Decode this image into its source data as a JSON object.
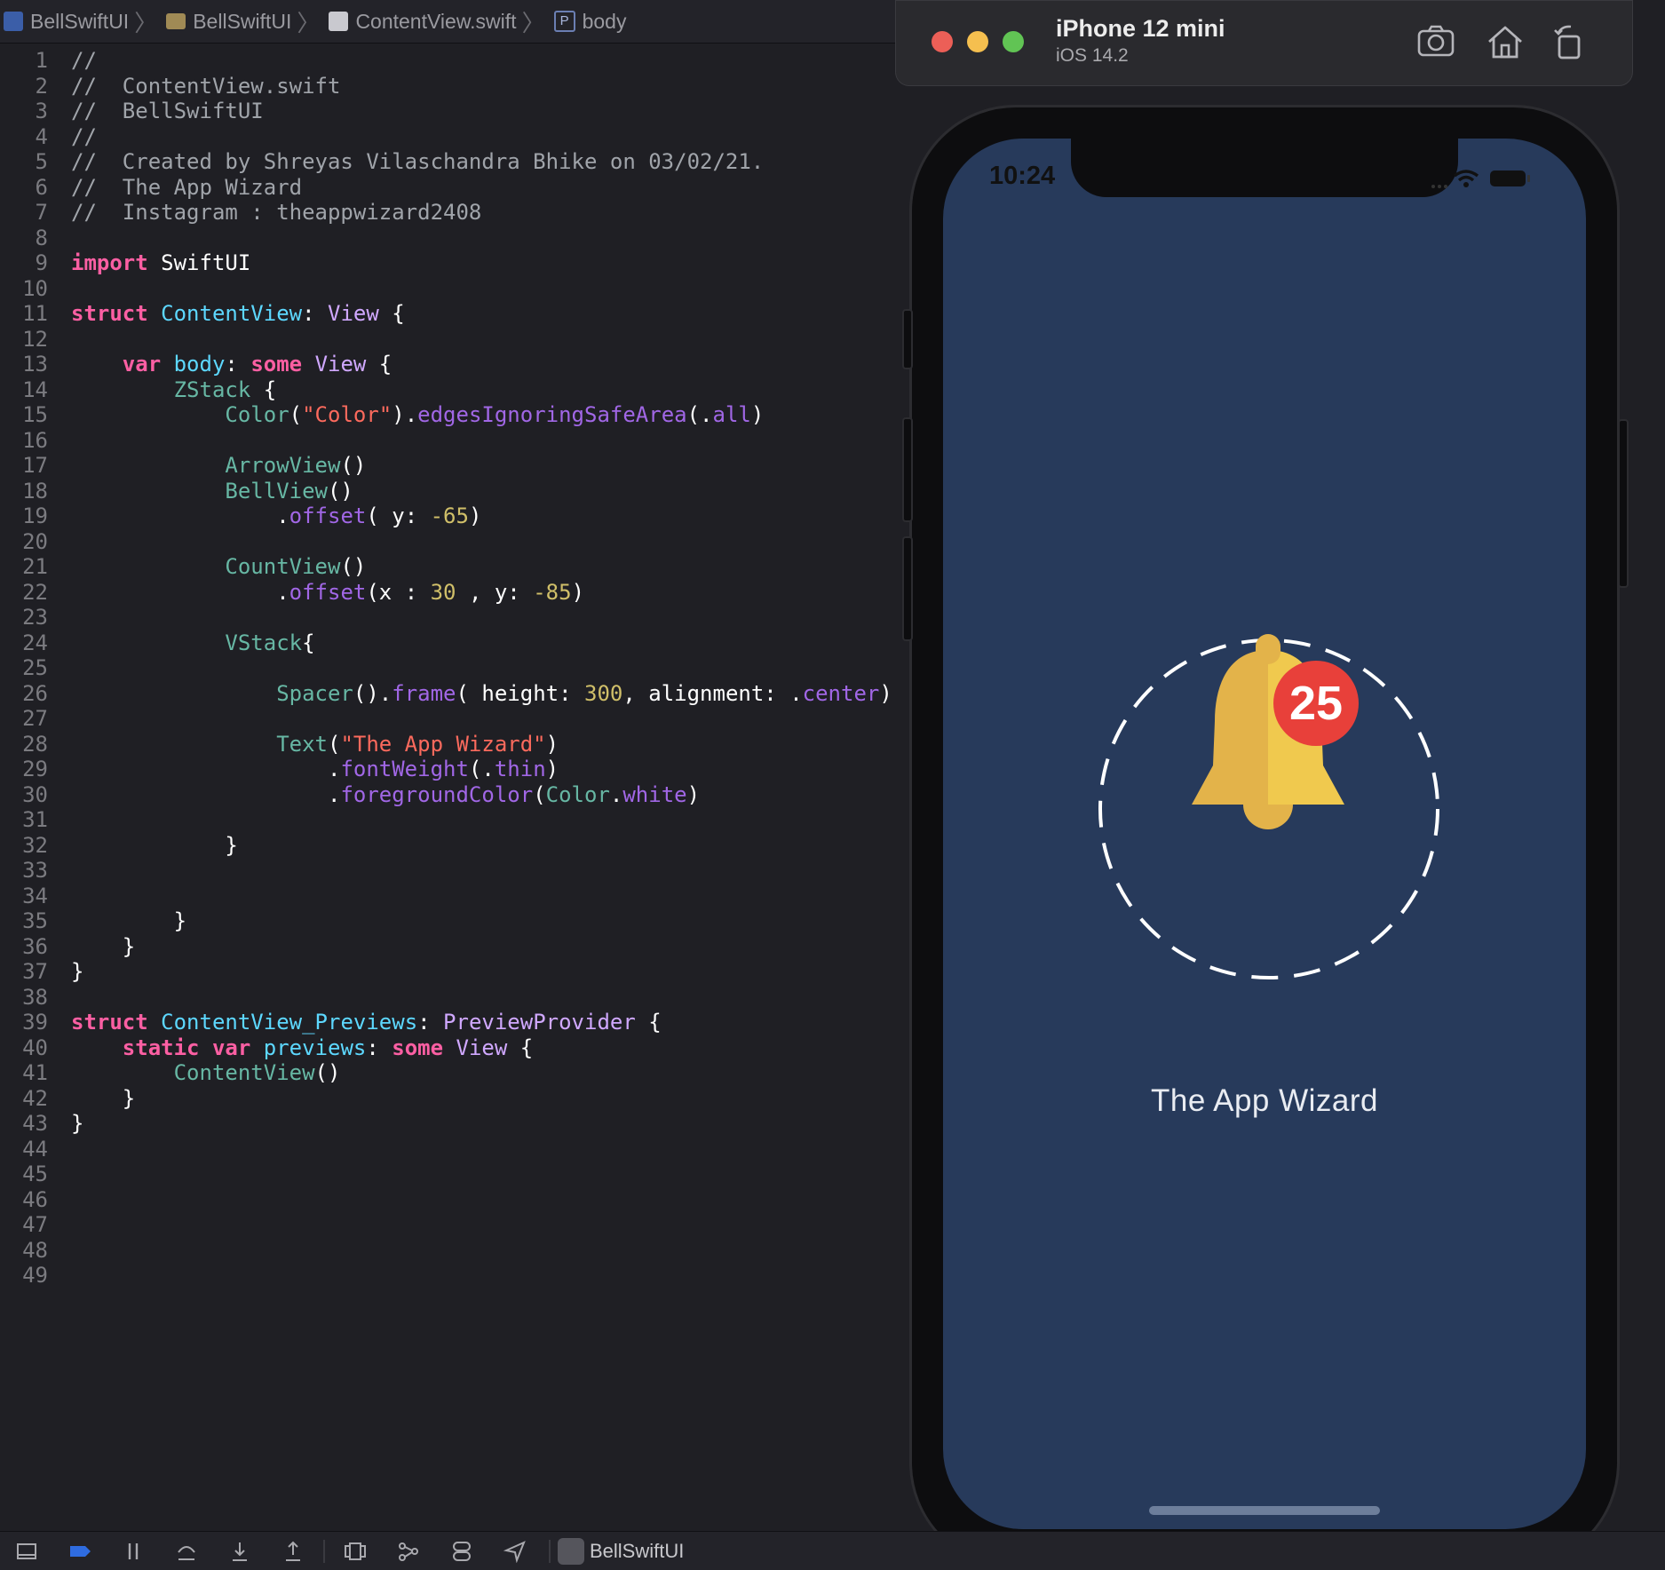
{
  "breadcrumb": {
    "project": "BellSwiftUI",
    "folder": "BellSwiftUI",
    "file": "ContentView.swift",
    "symbol_badge": "P",
    "symbol": "body"
  },
  "editor": {
    "lines": [
      {
        "n": "1",
        "tokens": [
          {
            "c": "t-comment",
            "t": "//"
          }
        ]
      },
      {
        "n": "2",
        "tokens": [
          {
            "c": "t-comment",
            "t": "//  ContentView.swift"
          }
        ]
      },
      {
        "n": "3",
        "tokens": [
          {
            "c": "t-comment",
            "t": "//  BellSwiftUI"
          }
        ]
      },
      {
        "n": "4",
        "tokens": [
          {
            "c": "t-comment",
            "t": "//"
          }
        ]
      },
      {
        "n": "5",
        "tokens": [
          {
            "c": "t-comment",
            "t": "//  Created by Shreyas Vilaschandra Bhike on 03/02/21."
          }
        ]
      },
      {
        "n": "6",
        "tokens": [
          {
            "c": "t-comment",
            "t": "//  The App Wizard"
          }
        ]
      },
      {
        "n": "7",
        "tokens": [
          {
            "c": "t-comment",
            "t": "//  Instagram : theappwizard2408"
          }
        ]
      },
      {
        "n": "8",
        "tokens": []
      },
      {
        "n": "9",
        "tokens": [
          {
            "c": "t-kw",
            "t": "import"
          },
          {
            "c": "t-plain",
            "t": " SwiftUI"
          }
        ]
      },
      {
        "n": "10",
        "tokens": []
      },
      {
        "n": "11",
        "tokens": [
          {
            "c": "t-kw",
            "t": "struct"
          },
          {
            "c": "t-plain",
            "t": " "
          },
          {
            "c": "t-type",
            "t": "ContentView"
          },
          {
            "c": "t-plain",
            "t": ": "
          },
          {
            "c": "t-type2",
            "t": "View"
          },
          {
            "c": "t-plain",
            "t": " {"
          }
        ]
      },
      {
        "n": "12",
        "tokens": []
      },
      {
        "n": "13",
        "tokens": [
          {
            "c": "t-plain",
            "t": "    "
          },
          {
            "c": "t-kw",
            "t": "var"
          },
          {
            "c": "t-plain",
            "t": " "
          },
          {
            "c": "t-type",
            "t": "body"
          },
          {
            "c": "t-plain",
            "t": ": "
          },
          {
            "c": "t-kw",
            "t": "some"
          },
          {
            "c": "t-plain",
            "t": " "
          },
          {
            "c": "t-type2",
            "t": "View"
          },
          {
            "c": "t-plain",
            "t": " {"
          }
        ]
      },
      {
        "n": "14",
        "tokens": [
          {
            "c": "t-plain",
            "t": "        "
          },
          {
            "c": "t-call",
            "t": "ZStack"
          },
          {
            "c": "t-plain",
            "t": " {"
          }
        ]
      },
      {
        "n": "15",
        "tokens": [
          {
            "c": "t-plain",
            "t": "            "
          },
          {
            "c": "t-call",
            "t": "Color"
          },
          {
            "c": "t-plain",
            "t": "("
          },
          {
            "c": "t-str",
            "t": "\"Color\""
          },
          {
            "c": "t-plain",
            "t": ")."
          },
          {
            "c": "t-func",
            "t": "edgesIgnoringSafeArea"
          },
          {
            "c": "t-plain",
            "t": "(."
          },
          {
            "c": "t-member",
            "t": "all"
          },
          {
            "c": "t-plain",
            "t": ")"
          }
        ]
      },
      {
        "n": "16",
        "tokens": []
      },
      {
        "n": "17",
        "tokens": [
          {
            "c": "t-plain",
            "t": "            "
          },
          {
            "c": "t-call",
            "t": "ArrowView"
          },
          {
            "c": "t-plain",
            "t": "()"
          }
        ]
      },
      {
        "n": "18",
        "tokens": [
          {
            "c": "t-plain",
            "t": "            "
          },
          {
            "c": "t-call",
            "t": "BellView"
          },
          {
            "c": "t-plain",
            "t": "()"
          }
        ]
      },
      {
        "n": "19",
        "tokens": [
          {
            "c": "t-plain",
            "t": "                ."
          },
          {
            "c": "t-func",
            "t": "offset"
          },
          {
            "c": "t-plain",
            "t": "( y: "
          },
          {
            "c": "t-num",
            "t": "-65"
          },
          {
            "c": "t-plain",
            "t": ")"
          }
        ]
      },
      {
        "n": "20",
        "tokens": []
      },
      {
        "n": "21",
        "tokens": [
          {
            "c": "t-plain",
            "t": "            "
          },
          {
            "c": "t-call",
            "t": "CountView"
          },
          {
            "c": "t-plain",
            "t": "()"
          }
        ]
      },
      {
        "n": "22",
        "tokens": [
          {
            "c": "t-plain",
            "t": "                ."
          },
          {
            "c": "t-func",
            "t": "offset"
          },
          {
            "c": "t-plain",
            "t": "(x : "
          },
          {
            "c": "t-num",
            "t": "30"
          },
          {
            "c": "t-plain",
            "t": " , y: "
          },
          {
            "c": "t-num",
            "t": "-85"
          },
          {
            "c": "t-plain",
            "t": ")"
          }
        ]
      },
      {
        "n": "23",
        "tokens": []
      },
      {
        "n": "24",
        "tokens": [
          {
            "c": "t-plain",
            "t": "            "
          },
          {
            "c": "t-call",
            "t": "VStack"
          },
          {
            "c": "t-plain",
            "t": "{"
          }
        ]
      },
      {
        "n": "25",
        "tokens": []
      },
      {
        "n": "26",
        "tokens": [
          {
            "c": "t-plain",
            "t": "                "
          },
          {
            "c": "t-call",
            "t": "Spacer"
          },
          {
            "c": "t-plain",
            "t": "()."
          },
          {
            "c": "t-func",
            "t": "frame"
          },
          {
            "c": "t-plain",
            "t": "( height: "
          },
          {
            "c": "t-num",
            "t": "300"
          },
          {
            "c": "t-plain",
            "t": ", alignment: ."
          },
          {
            "c": "t-member",
            "t": "center"
          },
          {
            "c": "t-plain",
            "t": ")"
          }
        ]
      },
      {
        "n": "27",
        "tokens": []
      },
      {
        "n": "28",
        "tokens": [
          {
            "c": "t-plain",
            "t": "                "
          },
          {
            "c": "t-call",
            "t": "Text"
          },
          {
            "c": "t-plain",
            "t": "("
          },
          {
            "c": "t-str",
            "t": "\"The App Wizard\""
          },
          {
            "c": "t-plain",
            "t": ")"
          }
        ]
      },
      {
        "n": "29",
        "tokens": [
          {
            "c": "t-plain",
            "t": "                    ."
          },
          {
            "c": "t-func",
            "t": "fontWeight"
          },
          {
            "c": "t-plain",
            "t": "(."
          },
          {
            "c": "t-member",
            "t": "thin"
          },
          {
            "c": "t-plain",
            "t": ")"
          }
        ]
      },
      {
        "n": "30",
        "tokens": [
          {
            "c": "t-plain",
            "t": "                    ."
          },
          {
            "c": "t-func",
            "t": "foregroundColor"
          },
          {
            "c": "t-plain",
            "t": "("
          },
          {
            "c": "t-call",
            "t": "Color"
          },
          {
            "c": "t-plain",
            "t": "."
          },
          {
            "c": "t-member",
            "t": "white"
          },
          {
            "c": "t-plain",
            "t": ")"
          }
        ]
      },
      {
        "n": "31",
        "tokens": []
      },
      {
        "n": "32",
        "tokens": [
          {
            "c": "t-plain",
            "t": "            }"
          }
        ]
      },
      {
        "n": "33",
        "tokens": []
      },
      {
        "n": "34",
        "tokens": []
      },
      {
        "n": "35",
        "tokens": [
          {
            "c": "t-plain",
            "t": "        }"
          }
        ]
      },
      {
        "n": "36",
        "tokens": [
          {
            "c": "t-plain",
            "t": "    }"
          }
        ]
      },
      {
        "n": "37",
        "tokens": [
          {
            "c": "t-plain",
            "t": "}"
          }
        ]
      },
      {
        "n": "38",
        "tokens": []
      },
      {
        "n": "39",
        "tokens": [
          {
            "c": "t-kw",
            "t": "struct"
          },
          {
            "c": "t-plain",
            "t": " "
          },
          {
            "c": "t-type",
            "t": "ContentView_Previews"
          },
          {
            "c": "t-plain",
            "t": ": "
          },
          {
            "c": "t-type2",
            "t": "PreviewProvider"
          },
          {
            "c": "t-plain",
            "t": " {"
          }
        ]
      },
      {
        "n": "40",
        "tokens": [
          {
            "c": "t-plain",
            "t": "    "
          },
          {
            "c": "t-kw",
            "t": "static"
          },
          {
            "c": "t-plain",
            "t": " "
          },
          {
            "c": "t-kw",
            "t": "var"
          },
          {
            "c": "t-plain",
            "t": " "
          },
          {
            "c": "t-type",
            "t": "previews"
          },
          {
            "c": "t-plain",
            "t": ": "
          },
          {
            "c": "t-kw",
            "t": "some"
          },
          {
            "c": "t-plain",
            "t": " "
          },
          {
            "c": "t-type2",
            "t": "View"
          },
          {
            "c": "t-plain",
            "t": " {"
          }
        ]
      },
      {
        "n": "41",
        "tokens": [
          {
            "c": "t-plain",
            "t": "        "
          },
          {
            "c": "t-call",
            "t": "ContentView"
          },
          {
            "c": "t-plain",
            "t": "()"
          }
        ]
      },
      {
        "n": "42",
        "tokens": [
          {
            "c": "t-plain",
            "t": "    }"
          }
        ]
      },
      {
        "n": "43",
        "tokens": [
          {
            "c": "t-plain",
            "t": "}"
          }
        ]
      },
      {
        "n": "44",
        "tokens": []
      },
      {
        "n": "45",
        "tokens": []
      },
      {
        "n": "46",
        "tokens": []
      },
      {
        "n": "47",
        "tokens": []
      },
      {
        "n": "48",
        "tokens": []
      },
      {
        "n": "49",
        "tokens": []
      }
    ]
  },
  "simulator": {
    "device_name": "iPhone 12 mini",
    "os_version": "iOS 14.2",
    "traffic_lights": {
      "close": "#ec5f57",
      "minimize": "#f5bf4f",
      "zoom": "#61c454"
    },
    "toolbar_icons": [
      "screenshot-icon",
      "home-icon",
      "rotate-icon"
    ],
    "status_time": "10:24",
    "background_color": "#273a5b",
    "bell_color": "#f0c94e",
    "bell_shade_color": "#e3b34a",
    "badge_count": "25",
    "badge_color": "#e8403a",
    "app_text": "The App Wizard"
  },
  "bottom_bar": {
    "icons": [
      "sidebar-toggle-icon",
      "breakpoint-icon",
      "pause-icon",
      "step-over-icon",
      "step-into-icon",
      "step-out-icon",
      "view-debugger-icon",
      "memory-graph-icon",
      "environment-overrides-icon",
      "location-icon"
    ],
    "scheme_label": "BellSwiftUI"
  }
}
